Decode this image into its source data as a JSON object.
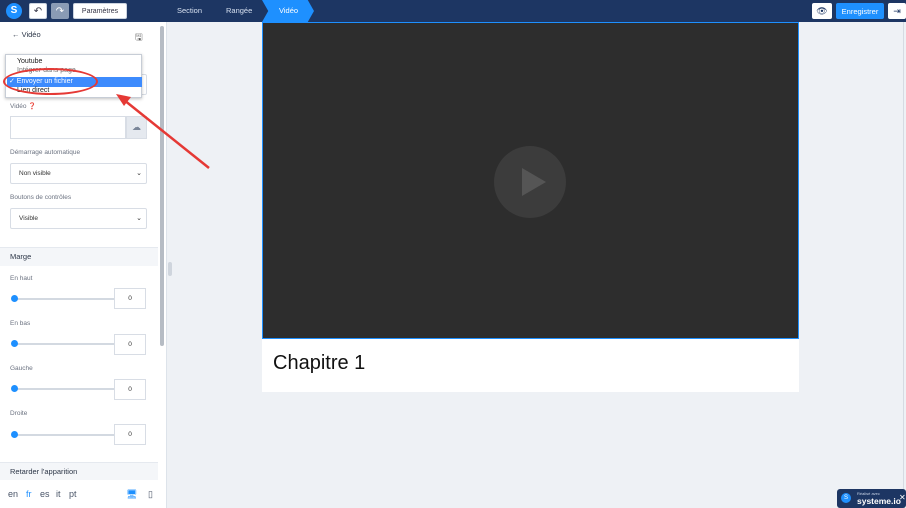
{
  "topbar": {
    "logo": "S",
    "params_label": "Paramètres",
    "breadcrumbs": [
      "Section",
      "Rangée",
      "Vidéo"
    ],
    "save_label": "Enregistrer",
    "icons": {
      "undo": "undo-icon",
      "redo": "redo-icon",
      "preview": "eye-icon",
      "exit": "exit-icon"
    }
  },
  "sidebar": {
    "back_label": "← Vidéo",
    "dropdown_options": [
      "Youtube",
      "Intégrer dans page",
      "Envoyer un fichier",
      "Lien direct"
    ],
    "selected_option": "✓ Envoyer un fichier",
    "video_label": "Vidéo",
    "autoplay_label": "Démarrage automatique",
    "autoplay_value": "Non visible",
    "controls_label": "Boutons de contrôles",
    "controls_value": "Visible",
    "margin_title": "Marge",
    "margins": [
      {
        "label": "En haut",
        "value": "0"
      },
      {
        "label": "En bas",
        "value": "0"
      },
      {
        "label": "Gauche",
        "value": "0"
      },
      {
        "label": "Droite",
        "value": "0"
      }
    ],
    "delay_title": "Retarder l'apparition",
    "languages": [
      "en",
      "fr",
      "es",
      "it",
      "pt"
    ],
    "active_language": "fr"
  },
  "canvas": {
    "chapter_title": "Chapitre 1"
  },
  "badge": {
    "small_text": "Réalisé avec",
    "name": "systeme.io",
    "close": "✕"
  },
  "colors": {
    "topbar": "#1d3663",
    "accent": "#1e90ff",
    "annotation": "#e53935"
  }
}
